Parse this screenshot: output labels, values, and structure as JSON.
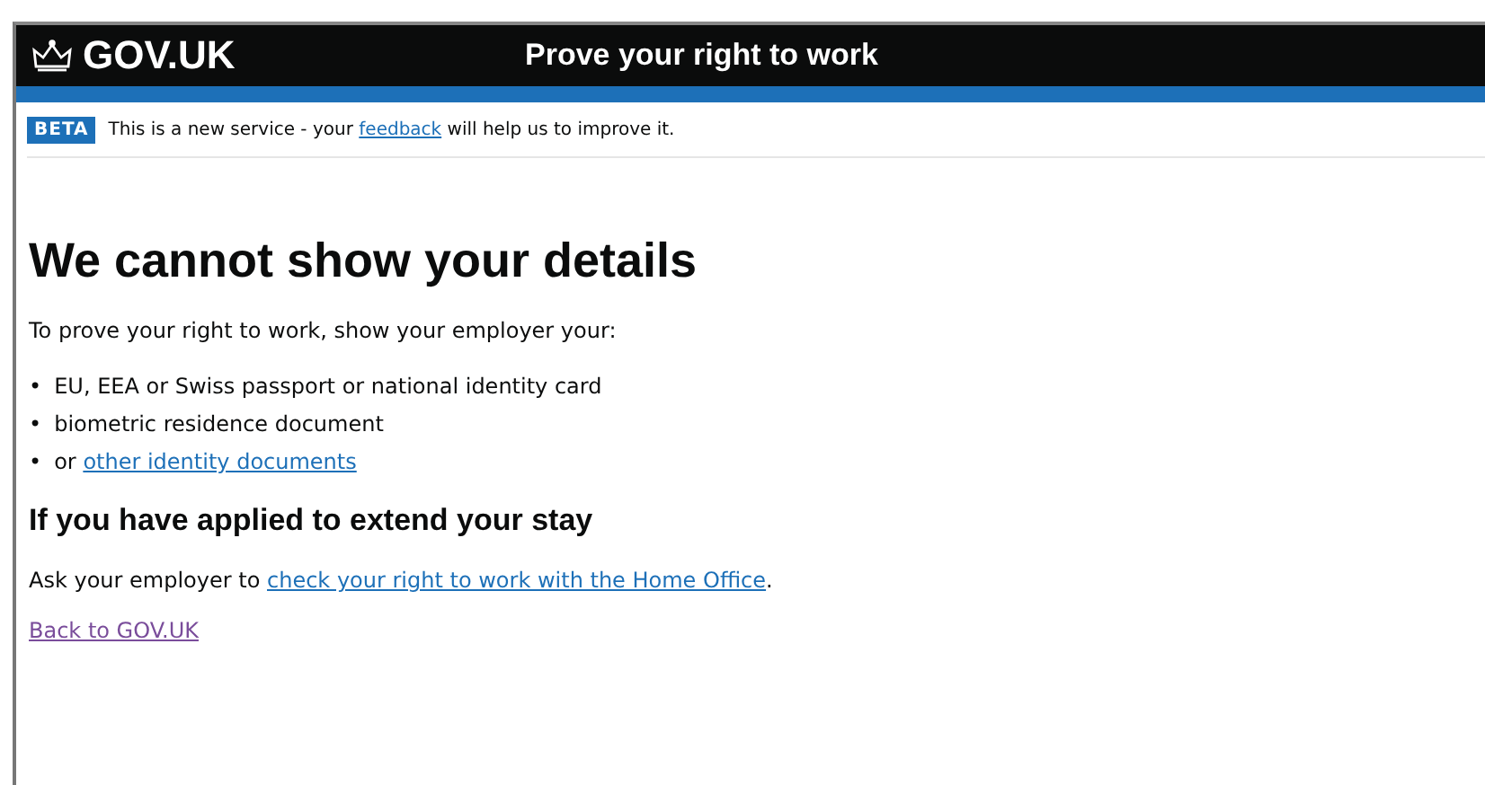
{
  "header": {
    "logo": "GOV.UK",
    "service_name": "Prove your right to work"
  },
  "phase_banner": {
    "tag": "BETA",
    "text_before": "This is a new service - your",
    "link": "feedback",
    "text_after": "will help us to improve it."
  },
  "heading": "We cannot show your details",
  "intro": "To prove your right to work, show your employer your:",
  "list": [
    {
      "marker": "•",
      "text": "EU, EEA or Swiss passport or national identity card"
    },
    {
      "marker": "•",
      "text": "biometric residence document"
    },
    {
      "marker": "•",
      "text": "or",
      "link": "other identity documents"
    }
  ],
  "subheading": "If you have applied to extend your stay",
  "extend_text": {
    "text_before": "Ask your employer to",
    "link": "check your right to work with the Home Office",
    "text_after": "."
  },
  "back_link": {
    "label": "Back to GOV.UK",
    "visited": true
  }
}
